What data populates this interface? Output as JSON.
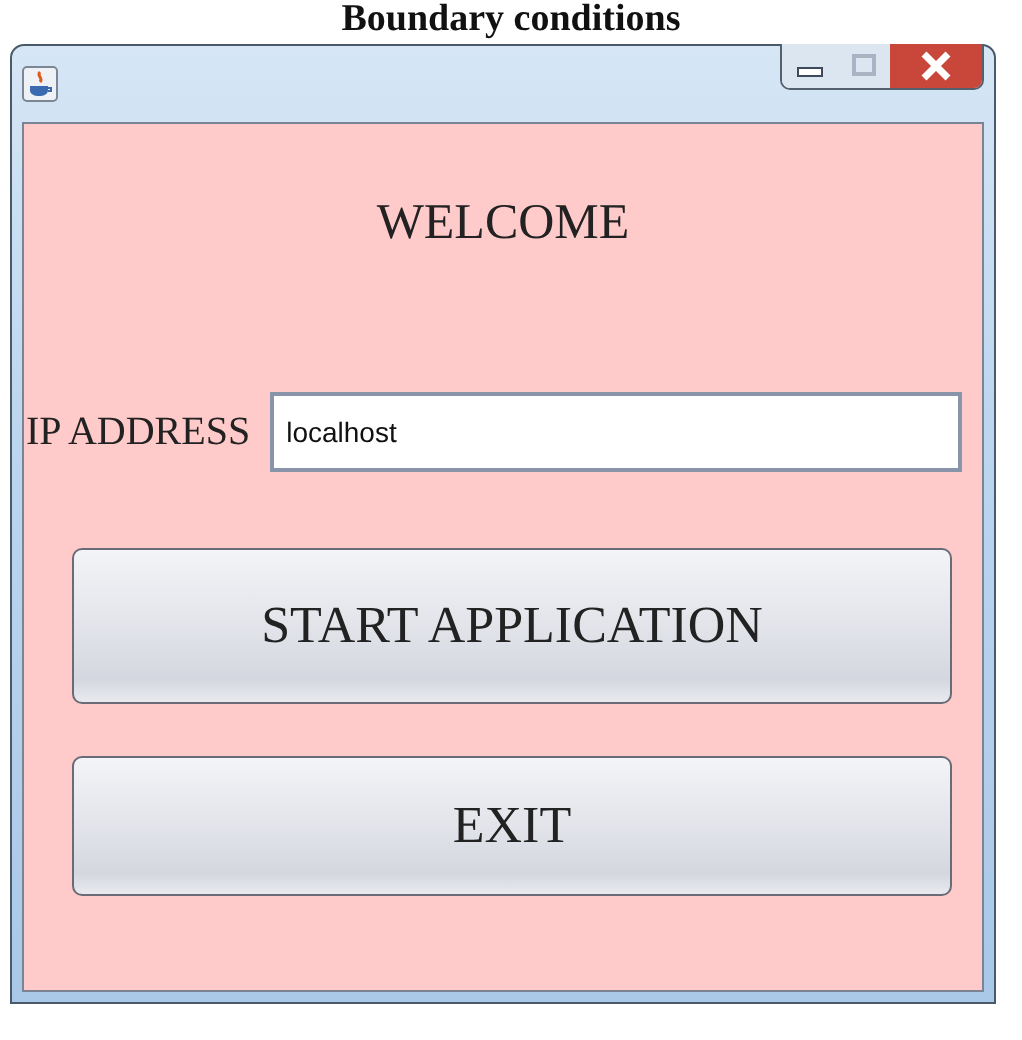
{
  "document_heading": "Boundary conditions",
  "window": {
    "title_bar": {
      "maximize_disabled": true
    }
  },
  "heading": "WELCOME",
  "ip_field": {
    "label": "IP ADDRESS",
    "value": "localhost"
  },
  "buttons": [
    {
      "label": "START APPLICATION"
    },
    {
      "label": "EXIT"
    }
  ]
}
